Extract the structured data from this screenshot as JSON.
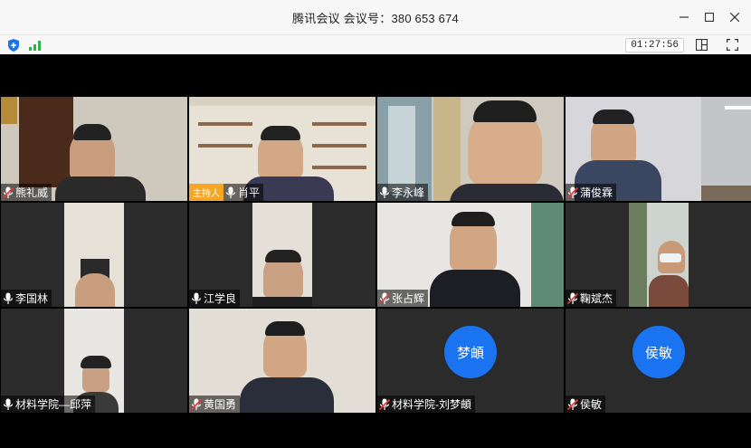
{
  "window": {
    "title": "腾讯会议 会议号：380 653 674",
    "minimize_icon": "minimize-icon",
    "maximize_icon": "maximize-icon",
    "close_icon": "close-icon"
  },
  "toolbar": {
    "security_icon": "shield-icon",
    "signal_icon": "signal-bars-icon",
    "timer": "01:27:56",
    "layout_icon": "layout-icon",
    "fullscreen_icon": "fullscreen-icon"
  },
  "participants": [
    {
      "name": "熊礼威",
      "mic": "muted",
      "host": false
    },
    {
      "name": "肖平",
      "mic": "on",
      "host": true,
      "host_label": "主持人"
    },
    {
      "name": "李永峰",
      "mic": "on",
      "host": false
    },
    {
      "name": "蒲俊霖",
      "mic": "muted",
      "host": false
    },
    {
      "name": "李国林",
      "mic": "on",
      "host": false
    },
    {
      "name": "江学良",
      "mic": "on",
      "host": false
    },
    {
      "name": "张占辉",
      "mic": "muted",
      "host": false
    },
    {
      "name": "鞠斌杰",
      "mic": "muted",
      "host": false
    },
    {
      "name": "材料学院—邱萍",
      "mic": "on",
      "host": false
    },
    {
      "name": "黄国勇",
      "mic": "muted",
      "host": false
    },
    {
      "name": "材料学院-刘梦頔",
      "mic": "muted",
      "host": false,
      "avatar_text": "梦頔"
    },
    {
      "name": "侯敏",
      "mic": "muted",
      "host": false,
      "avatar_text": "侯敏"
    }
  ],
  "colors": {
    "avatar_bg": "#1a73f0",
    "host_badge": "#f5a623",
    "muted_red": "#e23b3b"
  }
}
